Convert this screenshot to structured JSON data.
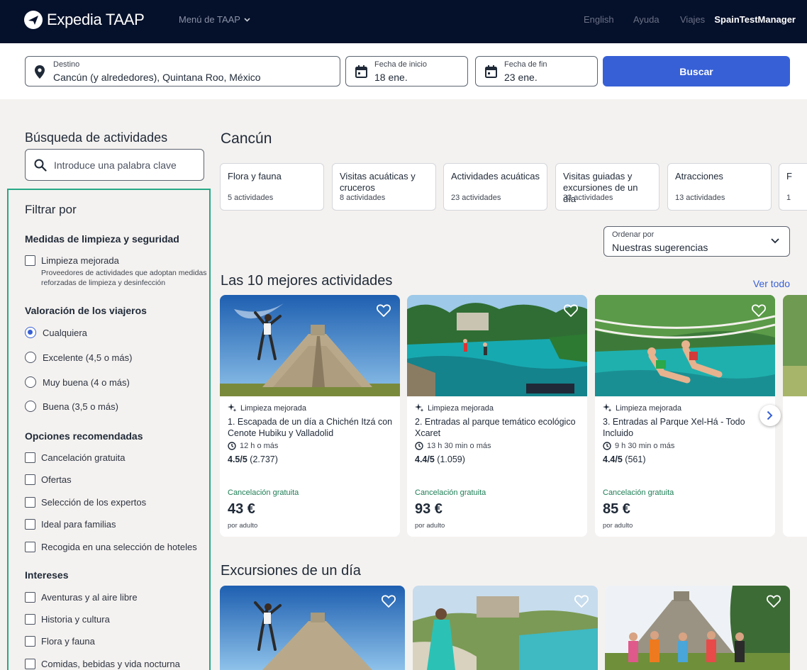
{
  "header": {
    "brand": "Expedia TAAP",
    "menu": "Menú de TAAP",
    "links": [
      "English",
      "Ayuda",
      "Viajes"
    ],
    "user": "SpainTestManager"
  },
  "search": {
    "destination_label": "Destino",
    "destination_value": "Cancún (y alrededores), Quintana Roo, México",
    "start_label": "Fecha de inicio",
    "start_value": "18 ene.",
    "end_label": "Fecha de fin",
    "end_value": "23 ene.",
    "button": "Buscar"
  },
  "sidebar": {
    "title": "Búsqueda de actividades",
    "keyword_placeholder": "Introduce una palabra clave",
    "filter_title": "Filtrar por",
    "cleaning": {
      "title": "Medidas de limpieza y seguridad",
      "option": "Limpieza mejorada",
      "description": "Proveedores de actividades que adoptan medidas reforzadas de limpieza y desinfección"
    },
    "rating": {
      "title": "Valoración de los viajeros",
      "options": [
        "Cualquiera",
        "Excelente (4,5 o más)",
        "Muy buena (4 o más)",
        "Buena (3,5 o más)"
      ],
      "selected": "Cualquiera"
    },
    "recommended": {
      "title": "Opciones recomendadas",
      "options": [
        "Cancelación gratuita",
        "Ofertas",
        "Selección de los expertos",
        "Ideal para familias",
        "Recogida en una selección de hoteles"
      ]
    },
    "interests": {
      "title": "Intereses",
      "options": [
        "Aventuras y al aire libre",
        "Historia y cultura",
        "Flora y fauna",
        "Comidas, bebidas y vida nocturna"
      ]
    }
  },
  "main": {
    "city": "Cancún",
    "categories": [
      {
        "name": "Flora y fauna",
        "count": "5 actividades"
      },
      {
        "name": "Visitas acuáticas y cruceros",
        "count": "8 actividades"
      },
      {
        "name": "Actividades acuáticas",
        "count": "23 actividades"
      },
      {
        "name": "Visitas guiadas y excursiones de un día",
        "count": "33 actividades"
      },
      {
        "name": "Atracciones",
        "count": "13 actividades"
      },
      {
        "name": "F",
        "count": "1"
      }
    ],
    "sort_label": "Ordenar por",
    "sort_value": "Nuestras sugerencias",
    "top10_title": "Las 10 mejores actividades",
    "see_all": "Ver todo",
    "top10": [
      {
        "badge": "Limpieza mejorada",
        "title": "1. Escapada de un día a Chichén Itzá con Cenote Hubiku y Valladolid",
        "duration": "12 h o más",
        "score": "4.5/5",
        "reviews": "(2.737)",
        "cancel": "Cancelación gratuita",
        "price": "43 €",
        "per": "por adulto"
      },
      {
        "badge": "Limpieza mejorada",
        "title": "2. Entradas al parque temático ecológico Xcaret",
        "duration": "13 h 30 min o más",
        "score": "4.4/5",
        "reviews": "(1.059)",
        "cancel": "Cancelación gratuita",
        "price": "93 €",
        "per": "por adulto"
      },
      {
        "badge": "Limpieza mejorada",
        "title": "3. Entradas al Parque Xel-Há - Todo Incluido",
        "duration": "9 h 30 min o más",
        "score": "4.4/5",
        "reviews": "(561)",
        "cancel": "Cancelación gratuita",
        "price": "85 €",
        "per": "por adulto"
      }
    ],
    "daytrips_title": "Excursiones de un día"
  },
  "colors": {
    "topbar": "#05102a",
    "accent": "#3760d6",
    "filter_outline": "#26a887",
    "free_cancel": "#1e7e56"
  }
}
